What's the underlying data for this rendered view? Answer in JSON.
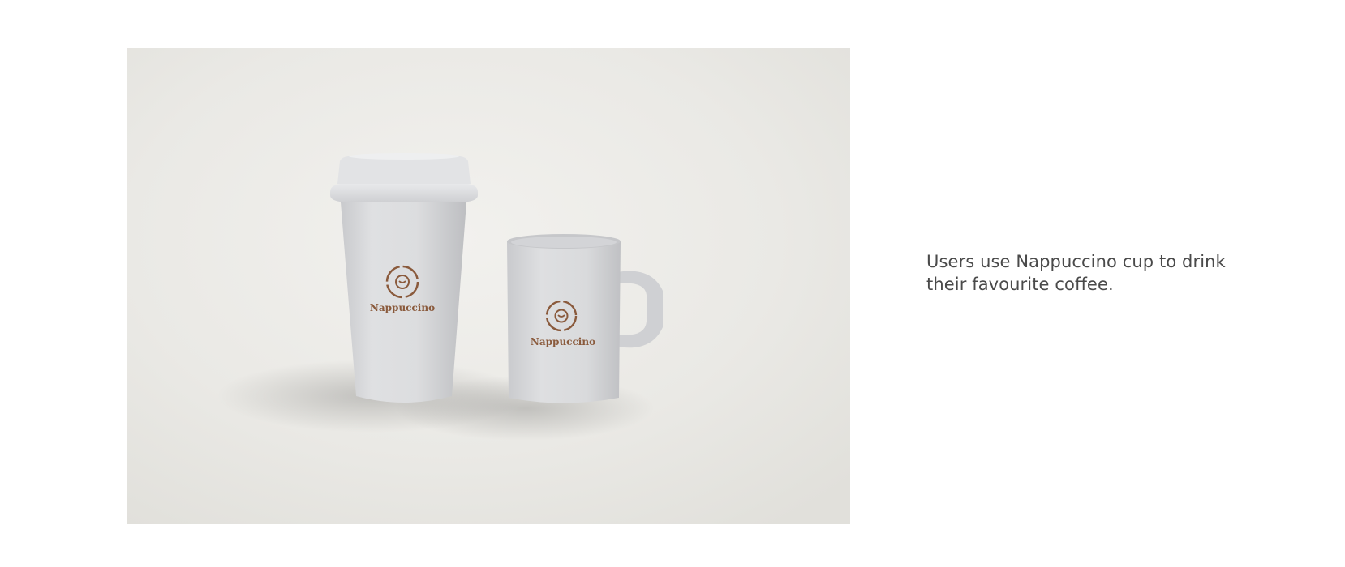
{
  "photo": {
    "brand_name": "Nappuccino",
    "logo_icon": "nappuccino-logo-icon",
    "logo_color": "#8a5a3c",
    "background_color": "#e9e8e4"
  },
  "caption": {
    "text": "Users use Nappuccino cup to drink their favourite coffee."
  }
}
